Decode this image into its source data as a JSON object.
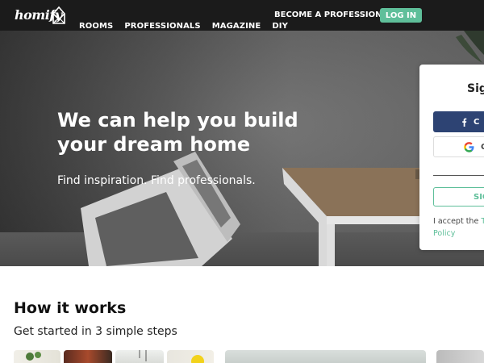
{
  "brand": {
    "logo_text": "homify",
    "logo_icon": "house-envelope-icon"
  },
  "nav": {
    "links": [
      {
        "label": "ROOMS"
      },
      {
        "label": "PROFESSIONALS"
      },
      {
        "label": "MAGAZINE"
      },
      {
        "label": "DIY"
      }
    ],
    "become_professional": "BECOME A PROFESSIONAL",
    "login": "LOG IN"
  },
  "hero": {
    "title": "We can help you build your dream home",
    "subtitle": "Find inspiration. Find professionals."
  },
  "signup": {
    "title_visible": "Sig",
    "facebook_label_visible": "C",
    "google_label_visible": "C",
    "signup_label_visible": "SIG",
    "terms_text_visible": "I accept the",
    "terms_link_visible": "Te",
    "policy_link_visible": "Policy"
  },
  "how_it_works": {
    "title": "How it works",
    "subtitle": "Get started in 3 simple steps"
  },
  "colors": {
    "nav_bg": "#1b1b1b",
    "accent_green": "#5fbf9a",
    "facebook_blue": "#2d4373"
  }
}
